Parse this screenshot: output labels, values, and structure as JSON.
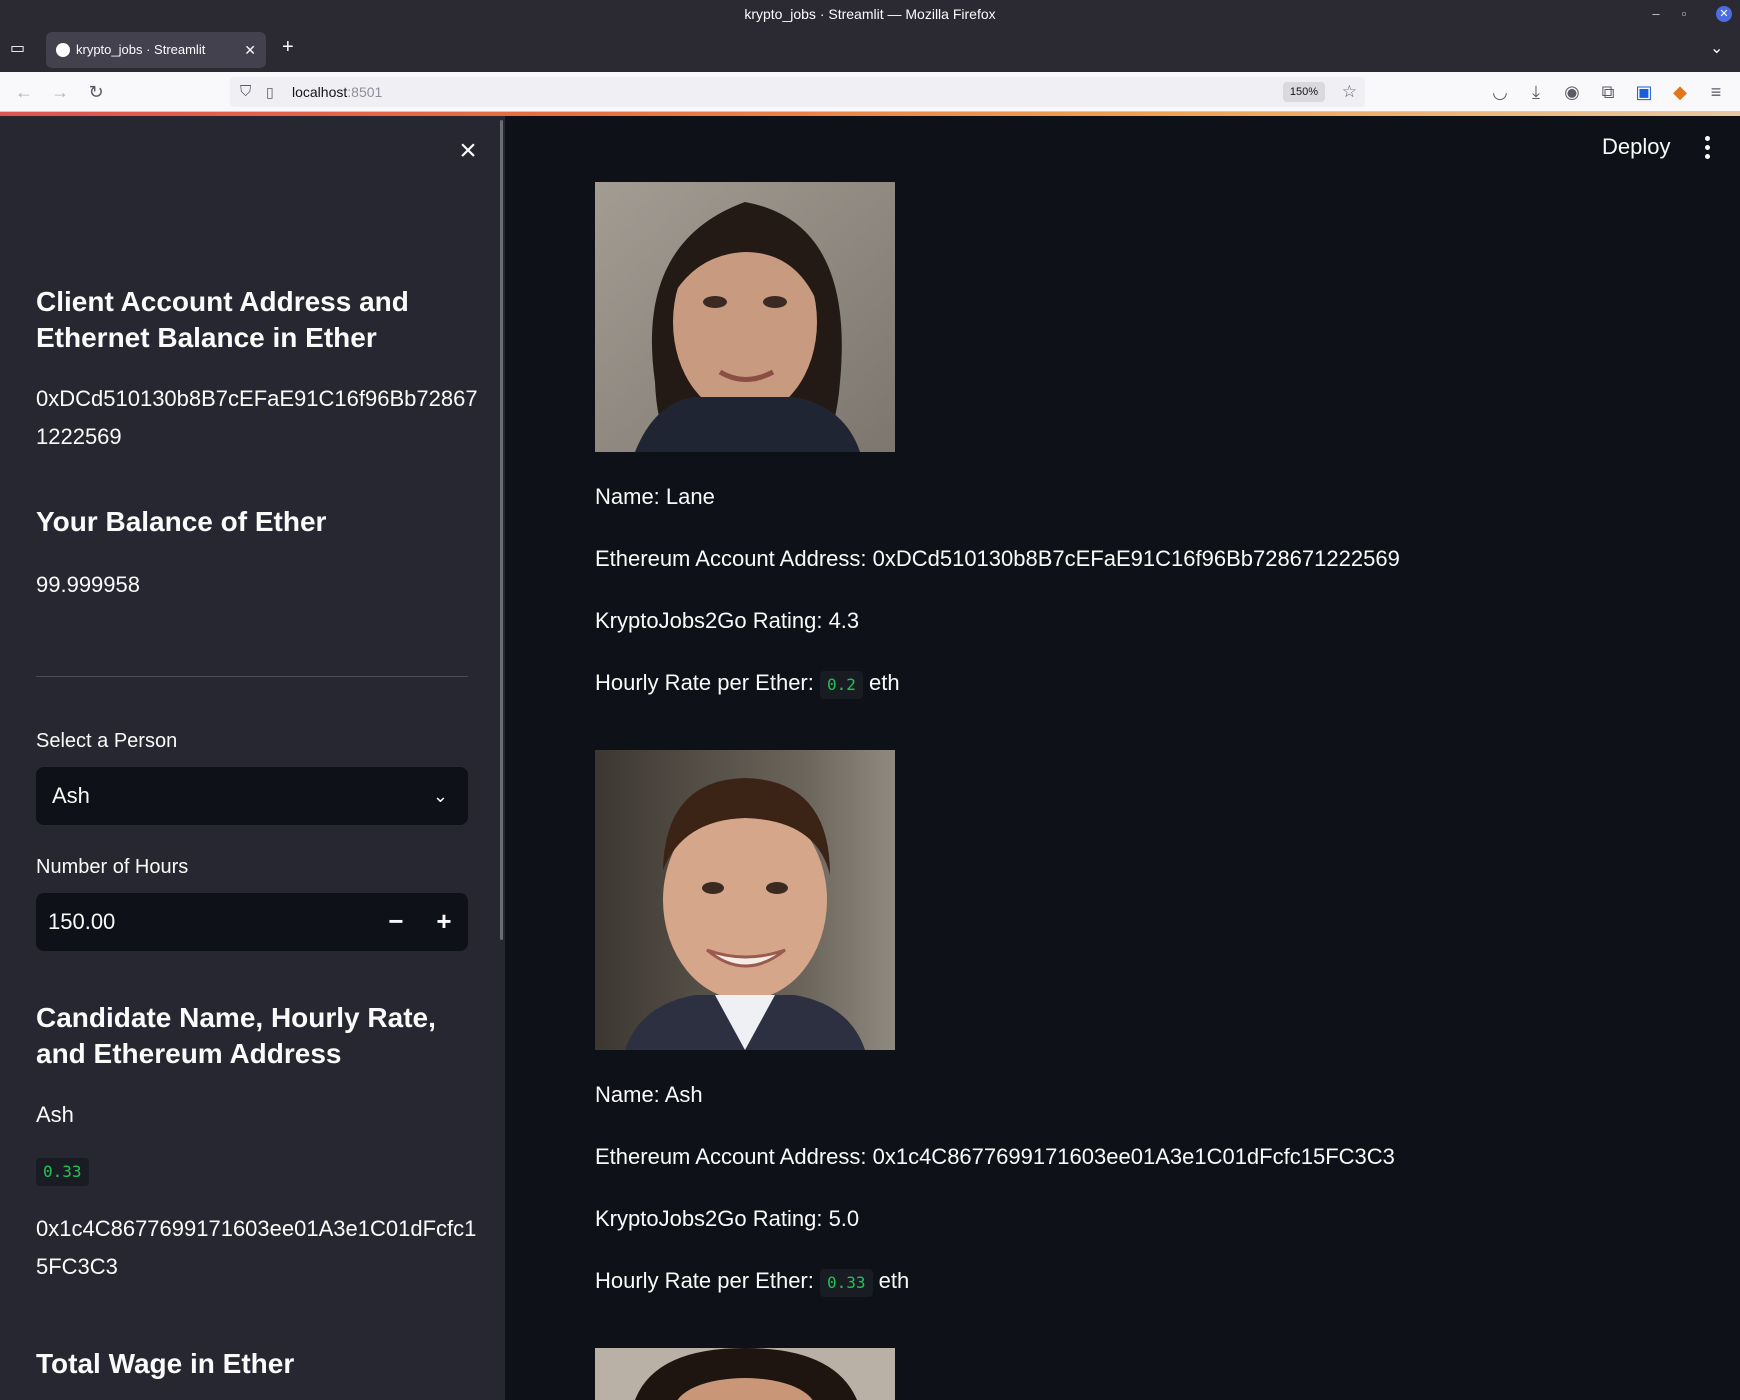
{
  "browser": {
    "window_title": "krypto_jobs · Streamlit — Mozilla Firefox",
    "tab_title": "krypto_jobs · Streamlit",
    "url_host": "localhost",
    "url_port": ":8501",
    "zoom": "150%"
  },
  "sidebar": {
    "client_heading": "Client Account Address and Ethernet Balance in Ether",
    "client_address_line1": "0xDCd510130b8B7cEFaE91C16f96Bb72867",
    "client_address_line2": "1222569",
    "balance_heading": "Your Balance of Ether",
    "balance_value": "99.999958",
    "select_label": "Select a Person",
    "select_value": "Ash",
    "hours_label": "Number of Hours",
    "hours_value": "150.00",
    "candidate_heading": "Candidate Name, Hourly Rate, and Ethereum Address",
    "candidate_name": "Ash",
    "candidate_rate": "0.33",
    "candidate_address_line1": "0x1c4C8677699171603ee01A3e1C01dFcfc1",
    "candidate_address_line2": "5FC3C3",
    "total_heading": "Total Wage in Ether"
  },
  "header": {
    "deploy_label": "Deploy"
  },
  "candidates": [
    {
      "name_line": "Name: Lane",
      "address_line": "Ethereum Account Address: 0xDCd510130b8B7cEFaE91C16f96Bb728671222569",
      "rating_line": "KryptoJobs2Go Rating: 4.3",
      "rate_prefix": "Hourly Rate per Ether:",
      "rate_value": "0.2",
      "rate_unit": "eth"
    },
    {
      "name_line": "Name: Ash",
      "address_line": "Ethereum Account Address: 0x1c4C8677699171603ee01A3e1C01dFcfc15FC3C3",
      "rating_line": "KryptoJobs2Go Rating: 5.0",
      "rate_prefix": "Hourly Rate per Ether:",
      "rate_value": "0.33",
      "rate_unit": "eth"
    }
  ],
  "icons": {
    "close": "×",
    "chevron": "⌄",
    "minus": "−",
    "plus": "+"
  }
}
